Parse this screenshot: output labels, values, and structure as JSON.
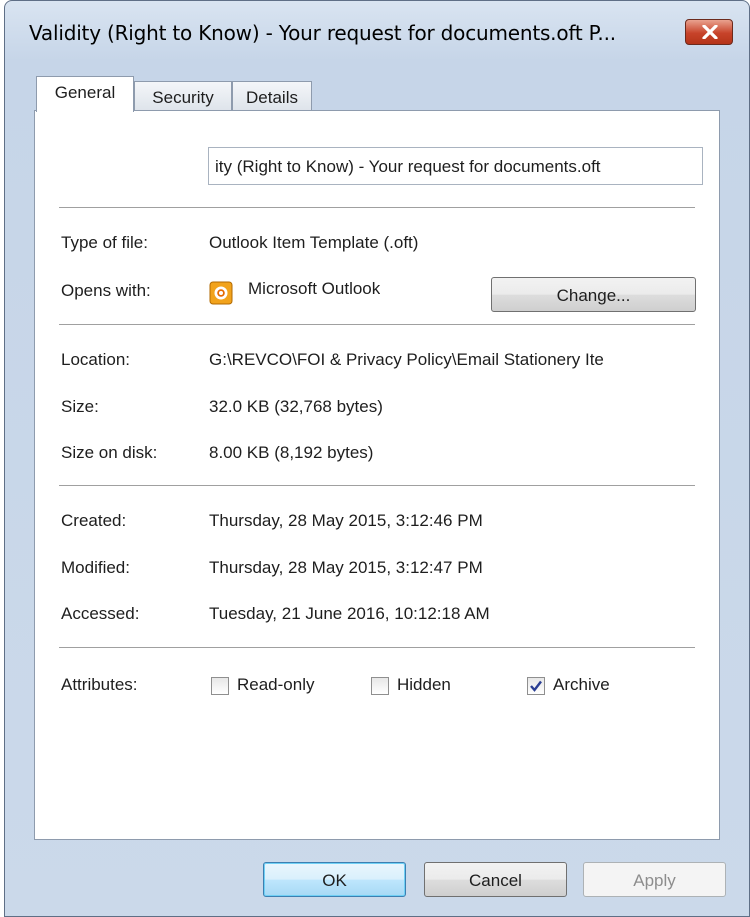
{
  "window": {
    "title": "Validity (Right to Know) - Your request for documents.oft P..."
  },
  "tabs": [
    {
      "label": "General"
    },
    {
      "label": "Security"
    },
    {
      "label": "Details"
    }
  ],
  "general": {
    "filename": "ity (Right to Know) - Your request for documents.oft",
    "type_label": "Type of file:",
    "type_value": "Outlook Item Template (.oft)",
    "opens_label": "Opens with:",
    "opens_value": "Microsoft Outlook",
    "change_label": "Change...",
    "location_label": "Location:",
    "location_value": "G:\\REVCO\\FOI & Privacy Policy\\Email Stationery Ite",
    "size_label": "Size:",
    "size_value": "32.0 KB (32,768 bytes)",
    "disk_label": "Size on disk:",
    "disk_value": "8.00 KB (8,192 bytes)",
    "created_label": "Created:",
    "created_value": "Thursday, 28 May 2015, 3:12:46 PM",
    "modified_label": "Modified:",
    "modified_value": "Thursday, 28 May 2015, 3:12:47 PM",
    "accessed_label": "Accessed:",
    "accessed_value": "Tuesday, 21 June 2016, 10:12:18 AM",
    "attributes_label": "Attributes:",
    "attributes": [
      {
        "label": "Read-only",
        "checked": false
      },
      {
        "label": "Hidden",
        "checked": false
      },
      {
        "label": "Archive",
        "checked": true
      }
    ]
  },
  "buttons": {
    "ok": "OK",
    "cancel": "Cancel",
    "apply": "Apply"
  },
  "icons": {
    "close": "close-icon",
    "outlook": "outlook-icon"
  }
}
